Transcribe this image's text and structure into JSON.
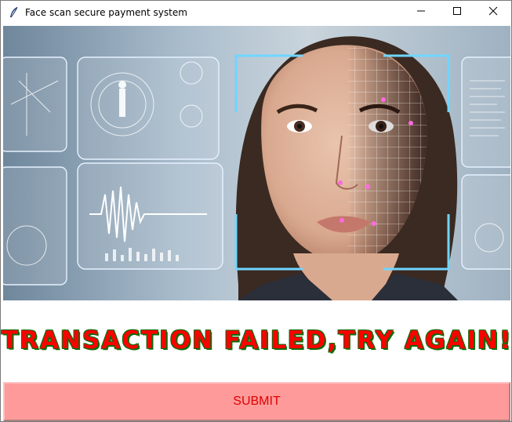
{
  "window": {
    "title": "Face scan secure payment system"
  },
  "controls": {
    "minimize_icon": "minimize-icon",
    "maximize_icon": "maximize-icon",
    "close_icon": "close-icon"
  },
  "banner": {
    "image": "face-scan-banner"
  },
  "status": {
    "message": "TRANSACTION FAILED,TRY AGAIN!",
    "color": "#ff0000",
    "outline_color": "#0a6e0a"
  },
  "submit": {
    "label": "SUBMIT",
    "bg_color": "#ff9a9a",
    "text_color": "#e00000"
  }
}
